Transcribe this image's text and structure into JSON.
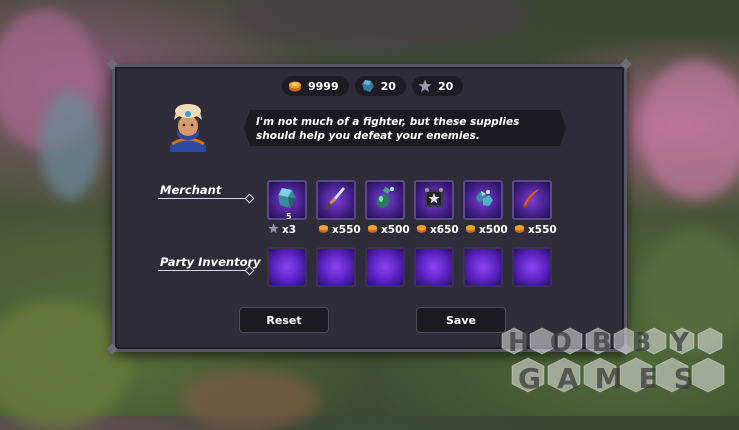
{
  "currency": {
    "gold": "9999",
    "gems": "20",
    "stars": "20"
  },
  "npc": {
    "dialogue": "I'm not much of a fighter, but these supplies should help you defeat your enemies."
  },
  "labels": {
    "merchant": "Merchant",
    "party_inventory": "Party Inventory"
  },
  "merchant_items": [
    {
      "icon": "crystal-shard-icon",
      "qty": "5",
      "price": "x3",
      "price_icon": "star-icon"
    },
    {
      "icon": "dagger-icon",
      "price": "x550",
      "price_icon": "gold-icon"
    },
    {
      "icon": "potion-flask-icon",
      "price": "x500",
      "price_icon": "gold-icon"
    },
    {
      "icon": "spellbook-icon",
      "price": "x650",
      "price_icon": "gold-icon"
    },
    {
      "icon": "gem-cluster-icon",
      "price": "x500",
      "price_icon": "gold-icon"
    },
    {
      "icon": "curved-blade-icon",
      "price": "x550",
      "price_icon": "gold-icon"
    }
  ],
  "buttons": {
    "reset": "Reset",
    "save": "Save"
  },
  "watermark": {
    "line1": "HOBBY",
    "line2": "GAMES"
  },
  "colors": {
    "panel": "#2e2c38",
    "slot_glow": "#8b45f0",
    "gold": "#f0a030"
  }
}
